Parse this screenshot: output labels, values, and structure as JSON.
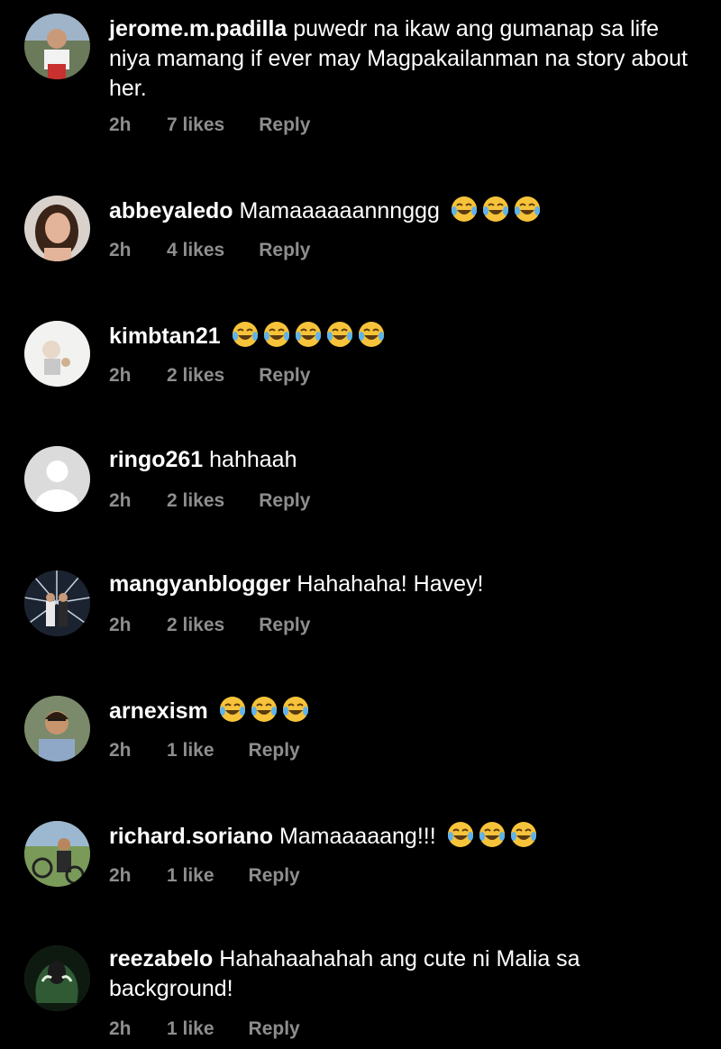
{
  "comments": [
    {
      "username": "jerome.m.padilla",
      "text": "puwedr na ikaw ang gumanap sa life niya mamang if ever may Magpakailanman na story about her.",
      "emoji_count": 0,
      "time": "2h",
      "likes": "7 likes",
      "reply": "Reply"
    },
    {
      "username": "abbeyaledo",
      "text": "Mamaaaaaannnggg",
      "emoji_count": 3,
      "time": "2h",
      "likes": "4 likes",
      "reply": "Reply"
    },
    {
      "username": "kimbtan21",
      "text": "",
      "emoji_count": 5,
      "time": "2h",
      "likes": "2 likes",
      "reply": "Reply"
    },
    {
      "username": "ringo261",
      "text": "hahhaah",
      "emoji_count": 0,
      "time": "2h",
      "likes": "2 likes",
      "reply": "Reply"
    },
    {
      "username": "mangyanblogger",
      "text": "Hahahaha! Havey!",
      "emoji_count": 0,
      "time": "2h",
      "likes": "2 likes",
      "reply": "Reply"
    },
    {
      "username": "arnexism",
      "text": "",
      "emoji_count": 3,
      "time": "2h",
      "likes": "1 like",
      "reply": "Reply"
    },
    {
      "username": "richard.soriano",
      "text": "Mamaaaaang!!!",
      "emoji_count": 3,
      "time": "2h",
      "likes": "1 like",
      "reply": "Reply"
    },
    {
      "username": "reezabelo",
      "text": "Hahahaahahah ang cute ni Malia sa background!",
      "emoji_count": 0,
      "time": "2h",
      "likes": "1 like",
      "reply": "Reply"
    }
  ],
  "emoji_icon": "face-with-tears-of-joy-icon",
  "colors": {
    "background": "#000000",
    "text": "#ffffff",
    "meta": "#8e8e8e"
  }
}
